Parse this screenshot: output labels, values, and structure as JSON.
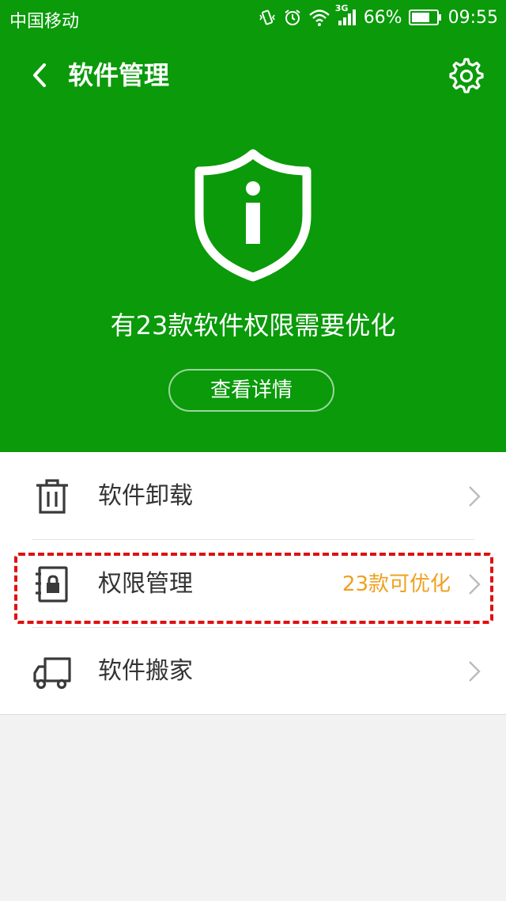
{
  "status_bar": {
    "carrier": "中国移动",
    "network": "3G",
    "battery": "66%",
    "time": "09:55",
    "icons": [
      "vibrate-icon",
      "alarm-icon",
      "wifi-icon",
      "signal-icon",
      "battery-icon"
    ]
  },
  "header": {
    "title": "软件管理",
    "back_icon": "back-arrow-icon",
    "settings_icon": "gear-icon"
  },
  "hero": {
    "icon": "shield-info-icon",
    "summary": "有23款软件权限需要优化",
    "details_button": "查看详情"
  },
  "menu": {
    "items": [
      {
        "label": "软件卸载",
        "icon": "trash-icon",
        "badge": ""
      },
      {
        "label": "权限管理",
        "icon": "lock-book-icon",
        "badge": "23款可优化"
      },
      {
        "label": "软件搬家",
        "icon": "truck-icon",
        "badge": ""
      }
    ]
  },
  "colors": {
    "header_green": "#0a9a0a",
    "badge_orange": "#f0a01e",
    "highlight_red": "#e01010"
  }
}
